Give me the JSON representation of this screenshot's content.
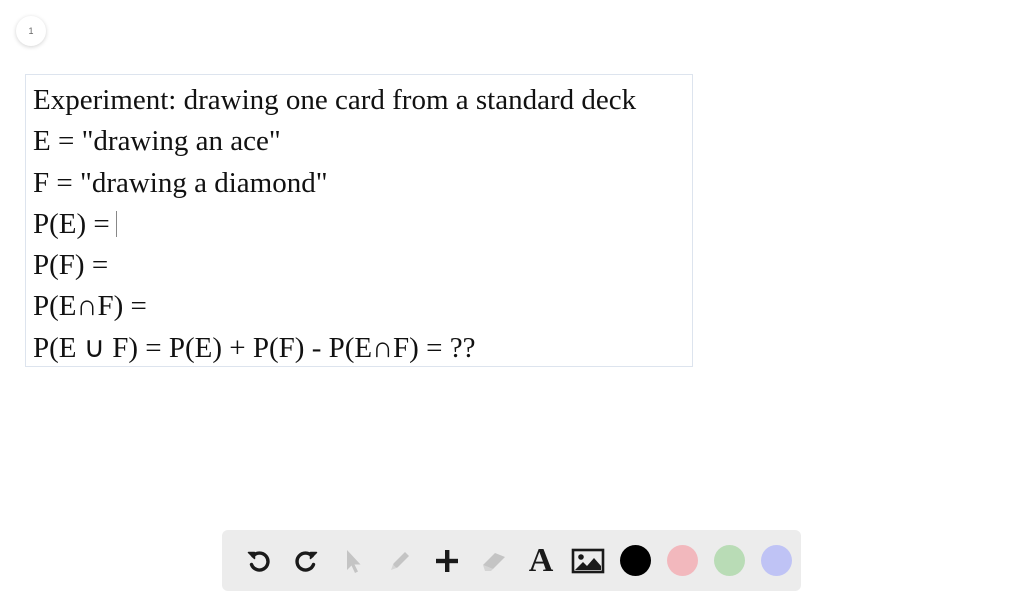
{
  "page": {
    "number": "1"
  },
  "text_box": {
    "lines": [
      "Experiment: drawing one card from a standard deck",
      "E = \"drawing an ace\"",
      "F = \"drawing a diamond\"",
      "P(E) =",
      "P(F) =",
      "P(E∩F) =",
      "P(E ∪ F) = P(E) + P(F) - P(E∩F) = ??"
    ]
  },
  "toolbar": {
    "tools": [
      {
        "name": "undo-icon",
        "enabled": true
      },
      {
        "name": "redo-icon",
        "enabled": true
      },
      {
        "name": "pointer-icon",
        "enabled": false
      },
      {
        "name": "pen-icon",
        "enabled": false
      },
      {
        "name": "plus-icon",
        "enabled": true
      },
      {
        "name": "eraser-icon",
        "enabled": false
      },
      {
        "name": "text-icon",
        "enabled": true
      },
      {
        "name": "image-icon",
        "enabled": true
      }
    ],
    "text_tool_glyph": "A",
    "colors": {
      "black": "#000000",
      "red": "#f2b8bd",
      "green": "#b9dcb6",
      "blue": "#bfc3f5"
    },
    "icon_active": "#1a1a1a",
    "icon_disabled": "#c4c4c4"
  }
}
